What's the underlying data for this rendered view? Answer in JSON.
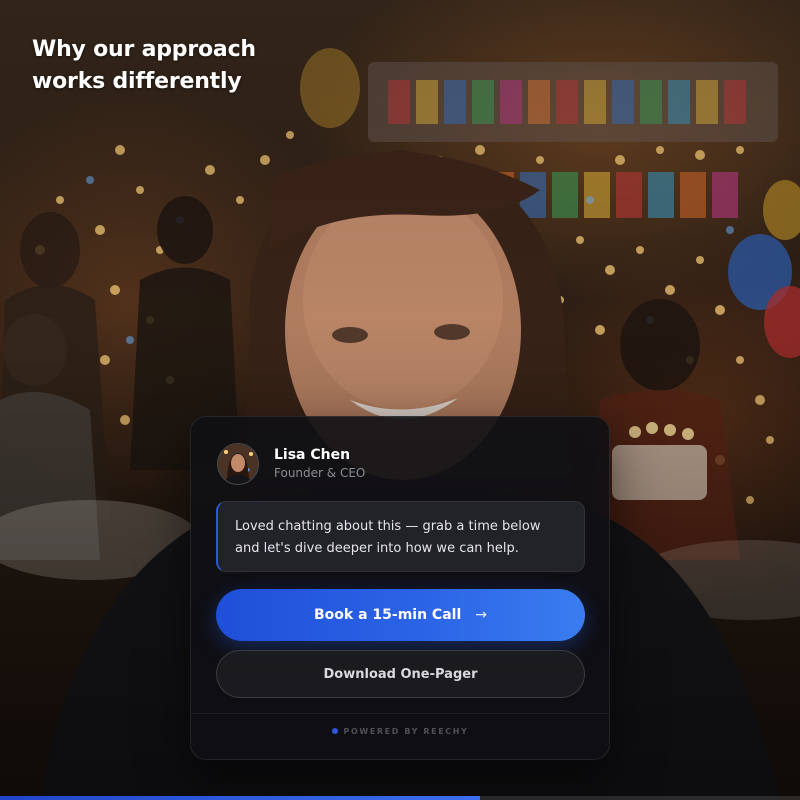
{
  "headline": "Why our approach works differently",
  "profile": {
    "name": "Lisa Chen",
    "role": "Founder & CEO"
  },
  "message": "Loved chatting about this — grab a time below and let's dive deeper into how we can help.",
  "actions": {
    "primary_label": "Book a 15-min Call",
    "primary_icon": "arrow-right-icon",
    "secondary_label": "Download One-Pager"
  },
  "footer": {
    "powered_by": "POWERED BY REECHY"
  },
  "progress": {
    "fraction": 0.6
  },
  "colors": {
    "accent": "#2b63e6",
    "card_bg": "#101014",
    "text_primary": "#ffffff",
    "text_muted": "#8c8c94"
  }
}
